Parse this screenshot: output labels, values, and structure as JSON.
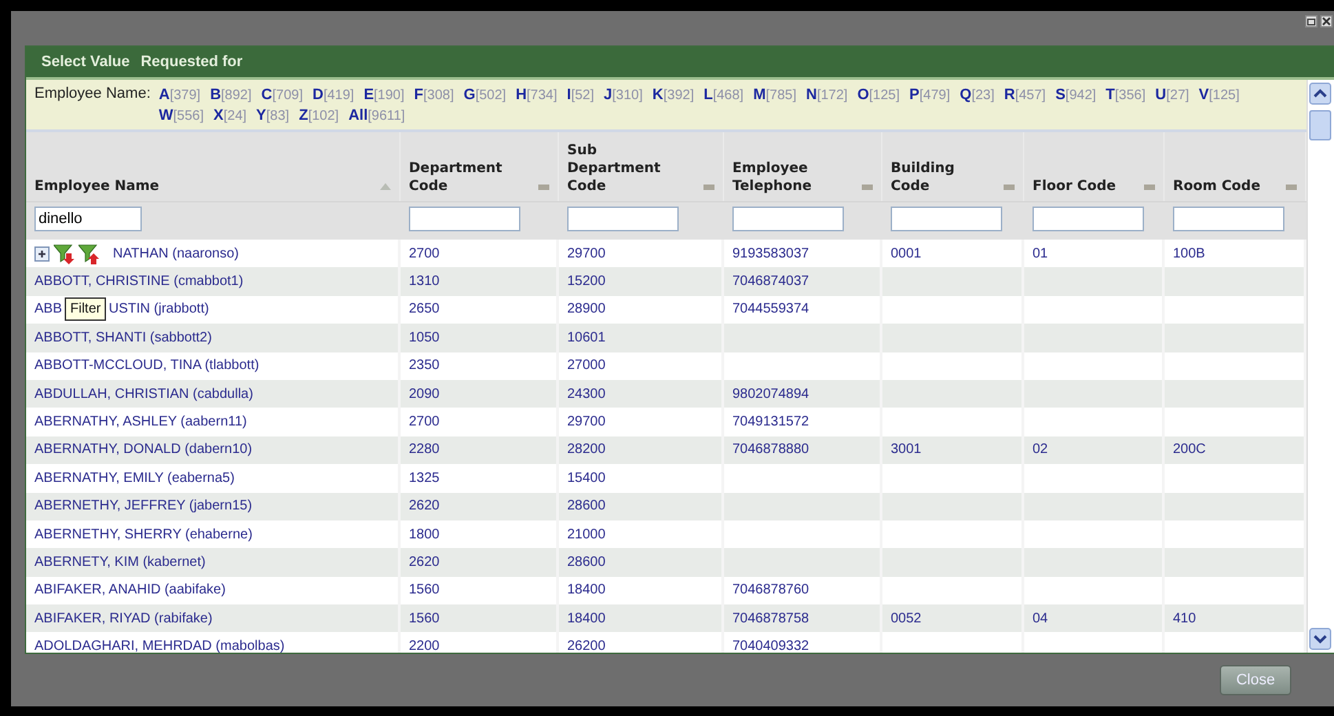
{
  "dialog": {
    "title": "Select Value",
    "subtitle": "Requested for"
  },
  "letter_filter": {
    "label": "Employee Name:",
    "letters": [
      {
        "letter": "A",
        "count": "[379]"
      },
      {
        "letter": "B",
        "count": "[892]"
      },
      {
        "letter": "C",
        "count": "[709]"
      },
      {
        "letter": "D",
        "count": "[419]"
      },
      {
        "letter": "E",
        "count": "[190]"
      },
      {
        "letter": "F",
        "count": "[308]"
      },
      {
        "letter": "G",
        "count": "[502]"
      },
      {
        "letter": "H",
        "count": "[734]"
      },
      {
        "letter": "I",
        "count": "[52]"
      },
      {
        "letter": "J",
        "count": "[310]"
      },
      {
        "letter": "K",
        "count": "[392]"
      },
      {
        "letter": "L",
        "count": "[468]"
      },
      {
        "letter": "M",
        "count": "[785]"
      },
      {
        "letter": "N",
        "count": "[172]"
      },
      {
        "letter": "O",
        "count": "[125]"
      },
      {
        "letter": "P",
        "count": "[479]"
      },
      {
        "letter": "Q",
        "count": "[23]"
      },
      {
        "letter": "R",
        "count": "[457]"
      },
      {
        "letter": "S",
        "count": "[942]"
      },
      {
        "letter": "T",
        "count": "[356]"
      },
      {
        "letter": "U",
        "count": "[27]"
      },
      {
        "letter": "V",
        "count": "[125]"
      },
      {
        "letter": "W",
        "count": "[556]"
      },
      {
        "letter": "X",
        "count": "[24]"
      },
      {
        "letter": "Y",
        "count": "[83]"
      },
      {
        "letter": "Z",
        "count": "[102]"
      },
      {
        "letter": "All",
        "count": "[9611]"
      }
    ]
  },
  "table": {
    "columns": [
      {
        "label": "Employee Name",
        "sorted": true,
        "filter_value": "dinello"
      },
      {
        "label": "Department Code",
        "sorted": false
      },
      {
        "label": "Sub Department Code",
        "sorted": false
      },
      {
        "label": "Employee Telephone",
        "sorted": false
      },
      {
        "label": "Building Code",
        "sorted": false
      },
      {
        "label": "Floor Code",
        "sorted": false
      },
      {
        "label": "Room Code",
        "sorted": false
      }
    ],
    "rows": [
      {
        "kind": "tools",
        "name": "NATHAN (naaronso)",
        "department_code": "2700",
        "sub_department_code": "29700",
        "telephone": "9193583037",
        "building_code": "0001",
        "floor_code": "01",
        "room_code": "100B"
      },
      {
        "kind": "plain",
        "name": "ABBOTT, CHRISTINE (cmabbot1)",
        "department_code": "1310",
        "sub_department_code": "15200",
        "telephone": "7046874037"
      },
      {
        "kind": "plain",
        "name": "ABB",
        "name_after_tooltip": "USTIN (jrabbott)",
        "department_code": "2650",
        "sub_department_code": "28900",
        "telephone": "7044559374"
      },
      {
        "kind": "plain",
        "name": "ABBOTT, SHANTI (sabbott2)",
        "department_code": "1050",
        "sub_department_code": "10601"
      },
      {
        "kind": "plain",
        "name": "ABBOTT-MCCLOUD, TINA (tlabbott)",
        "department_code": "2350",
        "sub_department_code": "27000"
      },
      {
        "kind": "plain",
        "name": "ABDULLAH, CHRISTIAN (cabdulla)",
        "department_code": "2090",
        "sub_department_code": "24300",
        "telephone": "9802074894"
      },
      {
        "kind": "plain",
        "name": "ABERNATHY, ASHLEY (aabern11)",
        "department_code": "2700",
        "sub_department_code": "29700",
        "telephone": "7049131572"
      },
      {
        "kind": "plain",
        "name": "ABERNATHY, DONALD (dabern10)",
        "department_code": "2280",
        "sub_department_code": "28200",
        "telephone": "7046878880",
        "building_code": "3001",
        "floor_code": "02",
        "room_code": "200C"
      },
      {
        "kind": "plain",
        "name": "ABERNATHY, EMILY (eaberna5)",
        "department_code": "1325",
        "sub_department_code": "15400"
      },
      {
        "kind": "plain",
        "name": "ABERNETHY, JEFFREY (jabern15)",
        "department_code": "2620",
        "sub_department_code": "28600"
      },
      {
        "kind": "plain",
        "name": "ABERNETHY, SHERRY (ehaberne)",
        "department_code": "1800",
        "sub_department_code": "21000"
      },
      {
        "kind": "plain",
        "name": "ABERNETY, KIM (kabernet)",
        "department_code": "2620",
        "sub_department_code": "28600"
      },
      {
        "kind": "plain",
        "name": "ABIFAKER, ANAHID (aabifake)",
        "department_code": "1560",
        "sub_department_code": "18400",
        "telephone": "7046878760"
      },
      {
        "kind": "plain",
        "name": "ABIFAKER, RIYAD (rabifake)",
        "department_code": "1560",
        "sub_department_code": "18400",
        "telephone": "7046878758",
        "building_code": "0052",
        "floor_code": "04",
        "room_code": "410"
      },
      {
        "kind": "plain",
        "name": "ADOLDAGHARI, MEHRDAD (mabolbas)",
        "department_code": "2200",
        "sub_department_code": "26200",
        "telephone": "7040409332"
      }
    ]
  },
  "tooltip": {
    "text": "Filter"
  },
  "footer": {
    "close_button": "Close"
  }
}
